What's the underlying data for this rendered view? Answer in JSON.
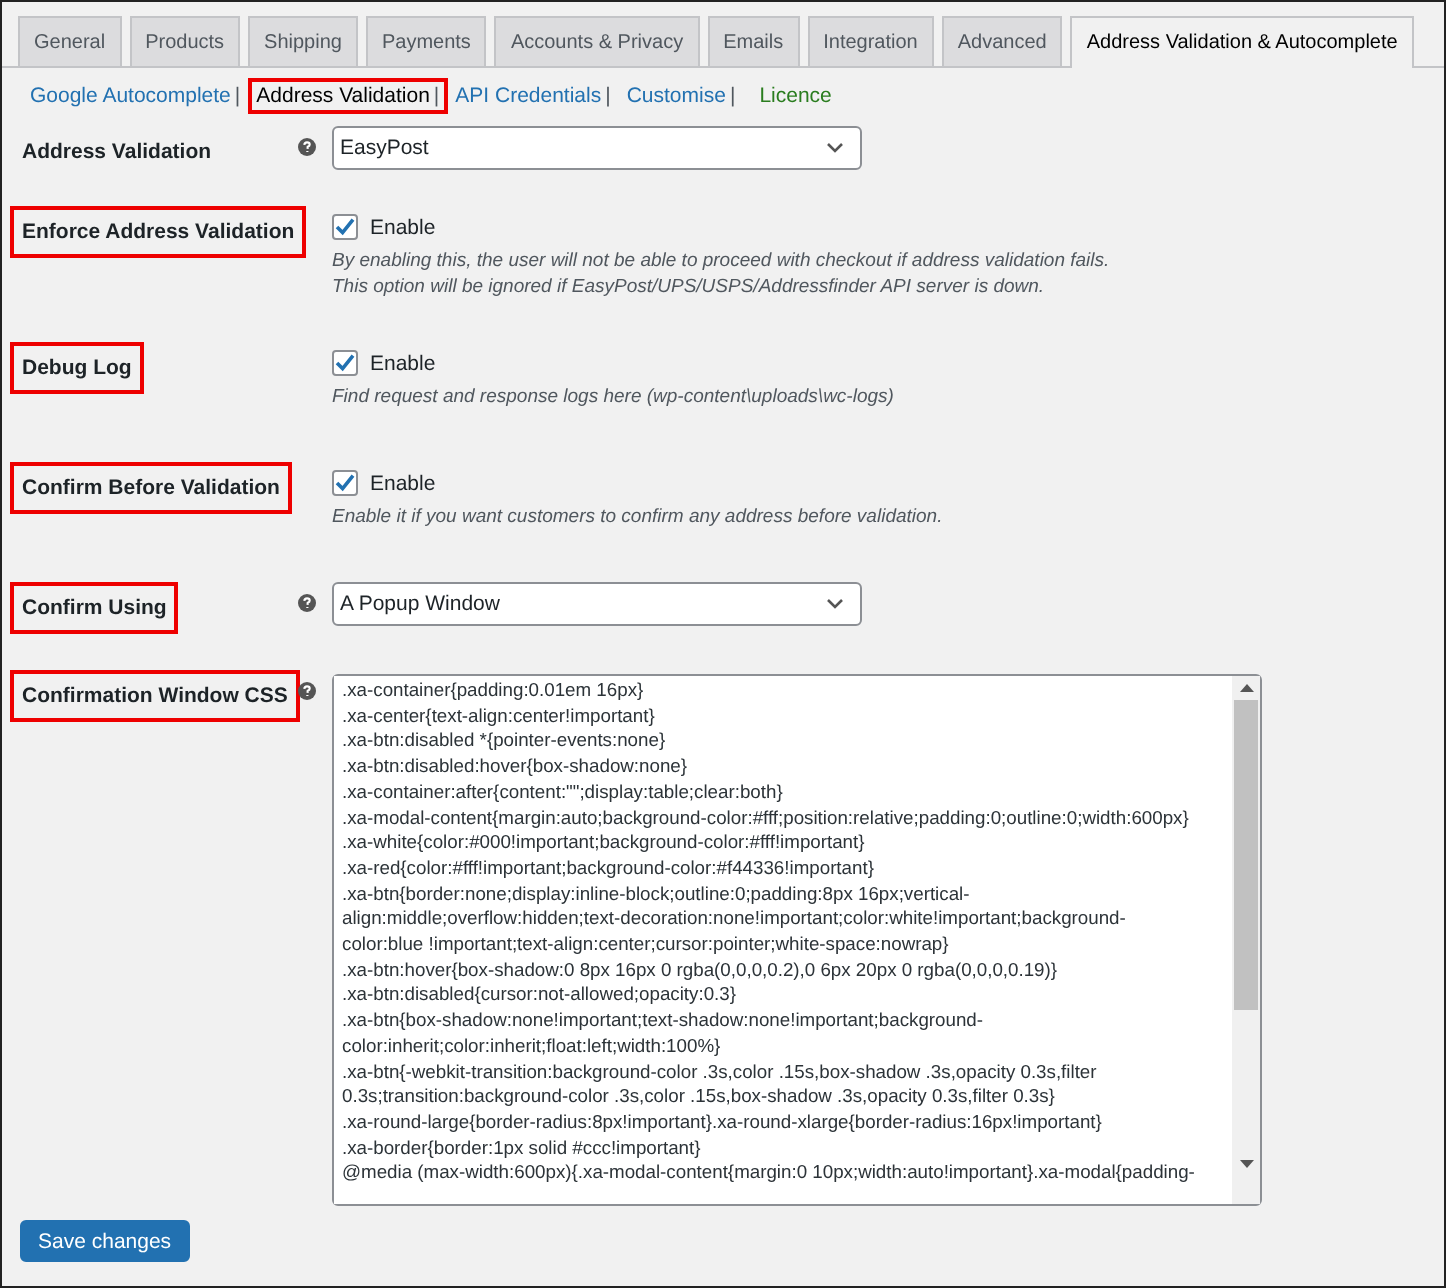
{
  "tabs": [
    {
      "label": "General",
      "selected": false
    },
    {
      "label": "Products",
      "selected": false
    },
    {
      "label": "Shipping",
      "selected": false
    },
    {
      "label": "Payments",
      "selected": false
    },
    {
      "label": "Accounts & Privacy",
      "selected": false
    },
    {
      "label": "Emails",
      "selected": false
    },
    {
      "label": "Integration",
      "selected": false
    },
    {
      "label": "Advanced",
      "selected": false
    },
    {
      "label": "Address Validation & Autocomplete",
      "selected": true
    }
  ],
  "subnav": [
    {
      "label": "Google Autocomplete",
      "separator": "|",
      "kind": "link",
      "selected": false,
      "highlighted": false
    },
    {
      "label": "Address Validation",
      "separator": "|",
      "kind": "link",
      "selected": true,
      "highlighted": true
    },
    {
      "label": "API Credentials",
      "separator": "|",
      "kind": "link",
      "selected": false,
      "highlighted": false
    },
    {
      "label": "Customise",
      "separator": "|",
      "kind": "link",
      "selected": false,
      "highlighted": false
    },
    {
      "label": "Licence",
      "kind": "licence",
      "selected": false,
      "highlighted": false
    }
  ],
  "settings": [
    {
      "kind": "select",
      "label": "Address Validation",
      "highlighted": false,
      "help_icon": true,
      "value": "EasyPost"
    },
    {
      "kind": "checkbox",
      "label": "Enforce Address Validation",
      "highlighted": true,
      "help_icon": false,
      "checked": true,
      "option": "Enable",
      "description": [
        "By enabling this, the user will not be able to proceed with checkout if address validation fails.",
        "This option will be ignored if EasyPost/UPS/USPS/Addressfinder API server is down."
      ]
    },
    {
      "kind": "checkbox",
      "label": "Debug Log",
      "highlighted": true,
      "help_icon": false,
      "checked": true,
      "option": "Enable",
      "description": [
        "Find request and response logs here (wp-content\\uploads\\wc-logs)"
      ]
    },
    {
      "kind": "checkbox",
      "label": "Confirm Before Validation",
      "highlighted": true,
      "help_icon": false,
      "checked": true,
      "option": "Enable",
      "description": [
        "Enable it if you want customers to confirm any address before validation."
      ]
    },
    {
      "kind": "select",
      "label": "Confirm Using",
      "highlighted": true,
      "help_icon": true,
      "value": "A Popup Window"
    },
    {
      "kind": "textarea",
      "label": "Confirmation Window CSS",
      "highlighted": true,
      "help_icon": true,
      "lines": [
        ".xa-container{padding:0.01em 16px}",
        ".xa-center{text-align:center!important}",
        ".xa-btn:disabled *{pointer-events:none}",
        ".xa-btn:disabled:hover{box-shadow:none}",
        ".xa-container:after{content:\"\";display:table;clear:both}",
        ".xa-modal-content{margin:auto;background-color:#fff;position:relative;padding:0;outline:0;width:600px}",
        ".xa-white{color:#000!important;background-color:#fff!important}",
        ".xa-red{color:#fff!important;background-color:#f44336!important}",
        ".xa-btn{border:none;display:inline-block;outline:0;padding:8px 16px;vertical-",
        "align:middle;overflow:hidden;text-decoration:none!important;color:white!important;background-",
        "color:blue !important;text-align:center;cursor:pointer;white-space:nowrap}",
        ".xa-btn:hover{box-shadow:0 8px 16px 0 rgba(0,0,0,0.2),0 6px 20px 0 rgba(0,0,0,0.19)}",
        ".xa-btn:disabled{cursor:not-allowed;opacity:0.3}",
        ".xa-btn{box-shadow:none!important;text-shadow:none!important;background-",
        "color:inherit;color:inherit;float:left;width:100%}",
        ".xa-btn{-webkit-transition:background-color .3s,color .15s,box-shadow .3s,opacity 0.3s,filter",
        "0.3s;transition:background-color .3s,color .15s,box-shadow .3s,opacity 0.3s,filter 0.3s}",
        ".xa-round-large{border-radius:8px!important}.xa-round-xlarge{border-radius:16px!important}",
        ".xa-border{border:1px solid #ccc!important}",
        "@media (max-width:600px){.xa-modal-content{margin:0 10px;width:auto!important}.xa-modal{padding-"
      ]
    }
  ],
  "save_button": "Save changes"
}
